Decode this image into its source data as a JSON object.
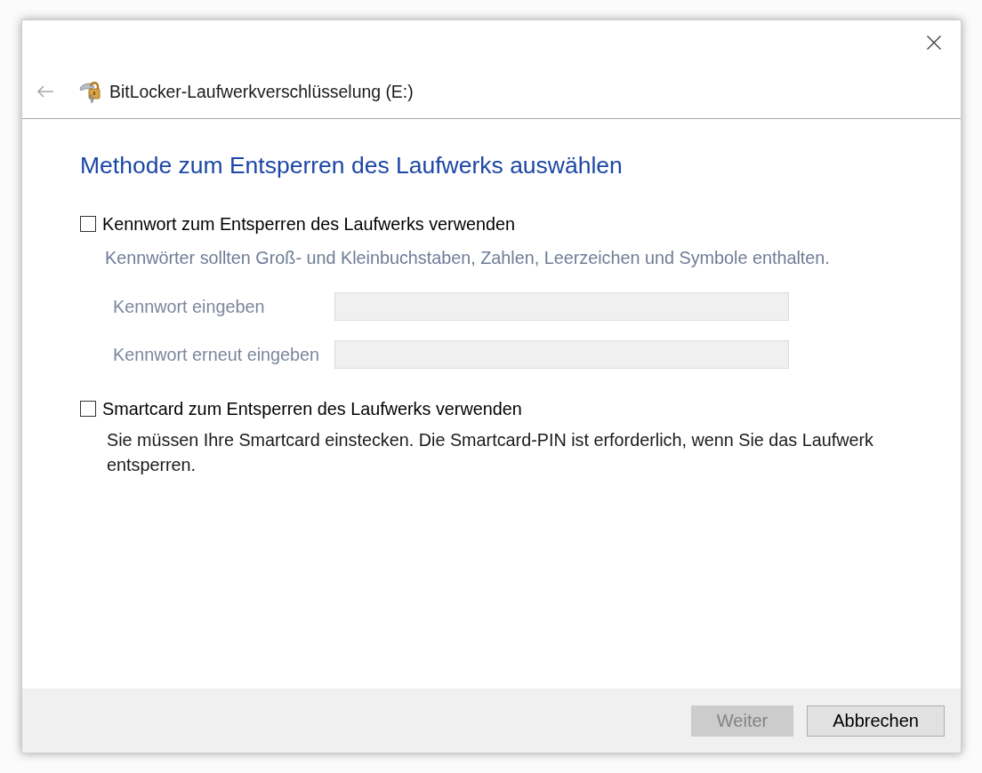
{
  "window": {
    "title": "BitLocker-Laufwerkverschlüsselung (E:)",
    "back_disabled": true
  },
  "heading": "Methode zum Entsperren des Laufwerks auswählen",
  "options": [
    {
      "label": "Kennwort zum Entsperren des Laufwerks verwenden",
      "checked": false,
      "details_disabled": true,
      "hint": "Kennwörter sollten Groß- und Kleinbuchstaben, Zahlen, Leerzeichen und Symbole enthalten.",
      "fields": [
        {
          "label": "Kennwort eingeben"
        },
        {
          "label": "Kennwort erneut eingeben"
        }
      ]
    },
    {
      "label": "Smartcard zum Entsperren des Laufwerks verwenden",
      "checked": false,
      "details_disabled": false,
      "description": "Sie müssen Ihre Smartcard einstecken. Die Smartcard-PIN ist erforderlich, wenn Sie das Laufwerk entsperren."
    }
  ],
  "buttons": [
    {
      "label": "Weiter",
      "disabled": true
    },
    {
      "label": "Abbrechen",
      "disabled": false
    }
  ]
}
